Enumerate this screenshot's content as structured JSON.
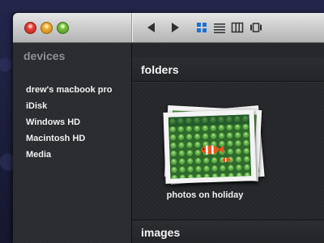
{
  "toolbar": {
    "traffic_lights": [
      {
        "name": "close",
        "color": "#e8453c"
      },
      {
        "name": "minimize",
        "color": "#f2b23a"
      },
      {
        "name": "zoom",
        "color": "#7cc443"
      }
    ],
    "nav": {
      "back_icon": "triangle-left-icon",
      "forward_icon": "triangle-right-icon"
    },
    "views": [
      {
        "name": "icon-view",
        "icon": "grid-icon",
        "selected": true,
        "color": "#1f6fd1"
      },
      {
        "name": "list-view",
        "icon": "list-icon",
        "selected": false
      },
      {
        "name": "column-view",
        "icon": "columns-icon",
        "selected": false
      },
      {
        "name": "coverflow-view",
        "icon": "coverflow-icon",
        "selected": false
      }
    ]
  },
  "sidebar": {
    "heading": "devices",
    "items": [
      {
        "label": "drew's macbook pro"
      },
      {
        "label": "iDisk"
      },
      {
        "label": "Windows HD"
      },
      {
        "label": "Macintosh HD"
      },
      {
        "label": "Media"
      }
    ]
  },
  "main": {
    "sections": [
      {
        "title": "folders",
        "items": [
          {
            "label": "photos on holiday",
            "thumbnail": "clownfish-in-anemone-photo"
          }
        ]
      },
      {
        "title": "images",
        "items": []
      }
    ]
  }
}
